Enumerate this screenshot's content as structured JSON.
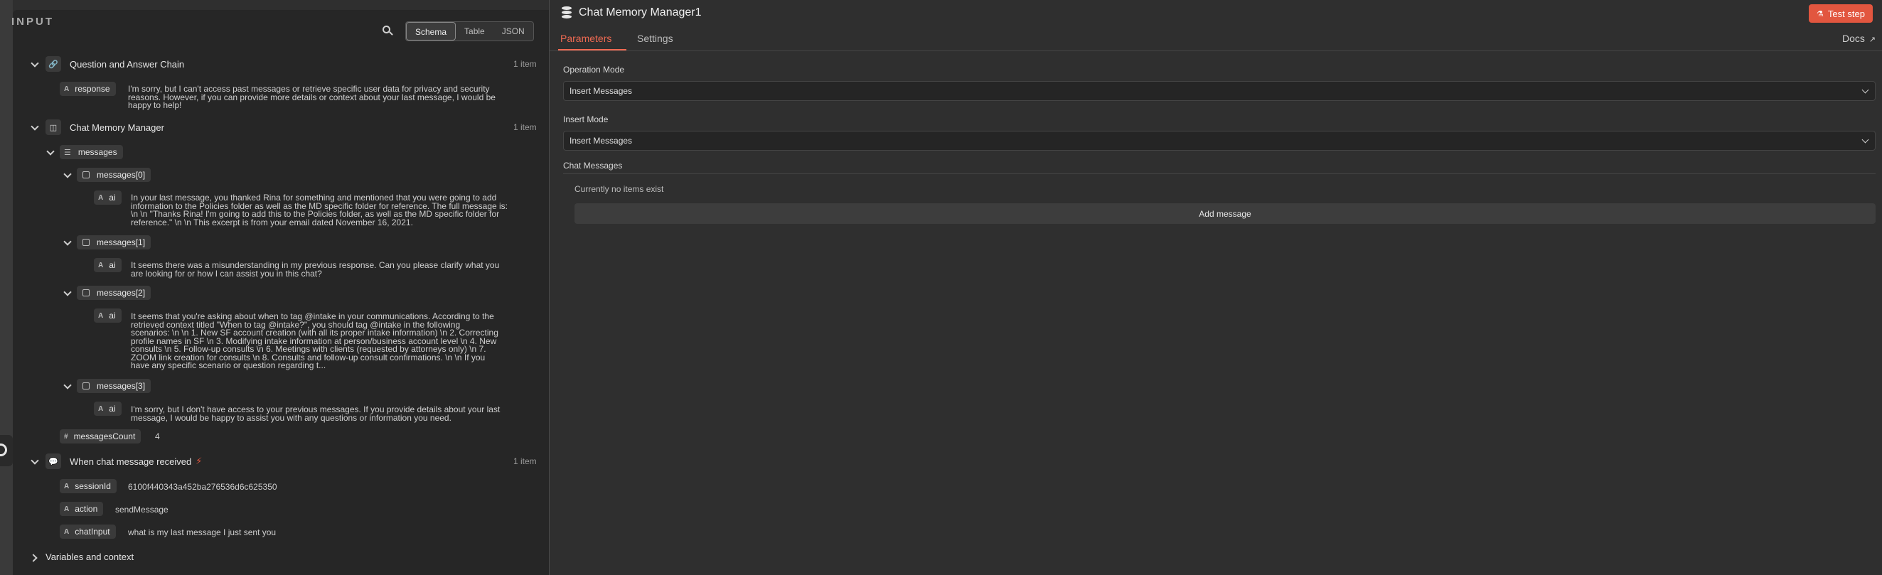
{
  "input": {
    "header": "INPUT",
    "view_modes": [
      "Schema",
      "Table",
      "JSON"
    ],
    "nodes": [
      {
        "title": "Question and Answer Chain",
        "count": "1 item",
        "response_label": "response",
        "response_lines": [
          "I'm sorry, but I can't access past messages or retrieve specific user data for privacy and security",
          "reasons. However, if you can provide more details or context about your last message, I would be",
          "happy to help!"
        ]
      },
      {
        "title": "Chat Memory Manager",
        "count": "1 item",
        "messages_label": "messages",
        "items": [
          {
            "label": "messages[0]",
            "field": "ai",
            "lines": [
              "In your last message, you thanked Rina for something and mentioned that you were going to add",
              "information to the Policies folder as well as the MD specific folder for reference. The full message is:",
              "\\n \\n \"Thanks Rina! I'm going to add this to the Policies folder, as well as the MD specific folder for",
              "reference.\" \\n \\n This excerpt is from your email dated November 16, 2021."
            ]
          },
          {
            "label": "messages[1]",
            "field": "ai",
            "lines": [
              "It seems there was a misunderstanding in my previous response. Can you please clarify what you",
              "are looking for or how I can assist you in this chat?"
            ]
          },
          {
            "label": "messages[2]",
            "field": "ai",
            "lines": [
              "It seems that you're asking about when to tag @intake in your communications. According to the",
              "retrieved context titled \"When to tag @intake?\", you should tag @intake in the following",
              "scenarios: \\n \\n 1. New SF account creation (with all its proper intake information) \\n 2. Correcting",
              "profile names in SF \\n 3. Modifying intake information at person/business account level \\n 4. New",
              "consults \\n 5. Follow-up consults \\n 6. Meetings with clients (requested by attorneys only) \\n 7.",
              "ZOOM link creation for consults \\n 8. Consults and follow-up consult confirmations. \\n \\n If you",
              "have any specific scenario or question regarding t..."
            ]
          },
          {
            "label": "messages[3]",
            "field": "ai",
            "lines": [
              "I'm sorry, but I don't have access to your previous messages. If you provide details about your last",
              "message, I would be happy to assist you with any questions or information you need."
            ]
          }
        ],
        "count_label": "messagesCount",
        "count_value": "4"
      },
      {
        "title": "When chat message received",
        "count": "1 item",
        "fields": [
          {
            "label": "sessionId",
            "value": "6100f440343a452ba276536d6c625350"
          },
          {
            "label": "action",
            "value": "sendMessage"
          },
          {
            "label": "chatInput",
            "value": "what is my last message I just sent you"
          }
        ]
      }
    ],
    "variables_label": "Variables and context"
  },
  "node_panel": {
    "title": "Chat Memory Manager1",
    "test_button": "Test step",
    "tabs": [
      "Parameters",
      "Settings"
    ],
    "docs": "Docs",
    "operation_mode_label": "Operation Mode",
    "operation_mode_value": "Insert Messages",
    "insert_mode_label": "Insert Mode",
    "insert_mode_value": "Insert Messages",
    "chat_messages_label": "Chat Messages",
    "empty_text": "Currently no items exist",
    "add_button": "Add message"
  },
  "colors": {
    "accent": "#ef6a52",
    "button": "#e2563f",
    "bolt": "#e2563f"
  }
}
